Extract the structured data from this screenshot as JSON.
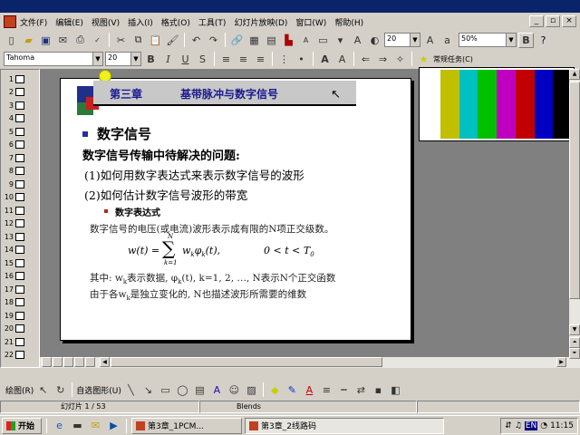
{
  "menu": [
    "文件(F)",
    "编辑(E)",
    "视图(V)",
    "插入(I)",
    "格式(O)",
    "工具(T)",
    "幻灯片放映(D)",
    "窗口(W)",
    "帮助(H)"
  ],
  "toolbar": {
    "font_size_main": "20",
    "zoom": "50%",
    "bold": "B",
    "help": "?"
  },
  "formatbar": {
    "font": "Tahoma",
    "size": "20",
    "bold": "B",
    "italic": "I",
    "underline": "U",
    "shadow": "S",
    "common_tasks": "常规任务(C)"
  },
  "slide_numbers": [
    "1",
    "2",
    "3",
    "4",
    "5",
    "6",
    "7",
    "8",
    "9",
    "10",
    "11",
    "12",
    "13",
    "14",
    "15",
    "16",
    "17",
    "18",
    "19",
    "20",
    "21",
    "22"
  ],
  "slide": {
    "chapter": "第三章",
    "title": "基带脉冲与数字信号",
    "bullet_heading": "数字信号",
    "line1": "数字信号传输中待解决的问题:",
    "line2": "(1)如何用数字表达式来表示数字信号的波形",
    "line3": "(2)如何估计数字信号波形的带宽",
    "sub_heading": "数字表达式",
    "line4": "数字信号的电压(或电流)波形表示成有限的N项正交级数。",
    "formula_lhs": "w(t) =",
    "sum_top": "N",
    "sum_bottom": "k=1",
    "formula_term": "w",
    "formula_sub1": "k",
    "formula_phi": "φ",
    "formula_sub2": "k",
    "formula_arg": "(t),",
    "formula_range": "0 < t < T",
    "formula_range_sub": "0",
    "line5": "其中: w",
    "line5_sub": "k",
    "line5_cont": "表示数据, φ",
    "line5_sub2": "k",
    "line5_tail": "(t), k=1, 2, …, N表示N个正交函数",
    "line6": "由于各w",
    "line6_sub": "k",
    "line6_tail": "是独立变化的, N也描述波形所需要的维数"
  },
  "colors": {
    "bars": [
      "#ffffff",
      "#c0c000",
      "#00c0c0",
      "#00c000",
      "#c000c0",
      "#c00000",
      "#0000c0",
      "#000000"
    ]
  },
  "drawbar": {
    "draw": "绘图(R)",
    "autoshapes": "自选图形(U)"
  },
  "status": {
    "slide": "幻灯片 1 / 53",
    "template": "Blends"
  },
  "taskbar": {
    "start": "开始",
    "task1": "第3章_1PCM...",
    "task2": "第3章_2线路码",
    "clock": "11:15",
    "lang": "EN"
  }
}
